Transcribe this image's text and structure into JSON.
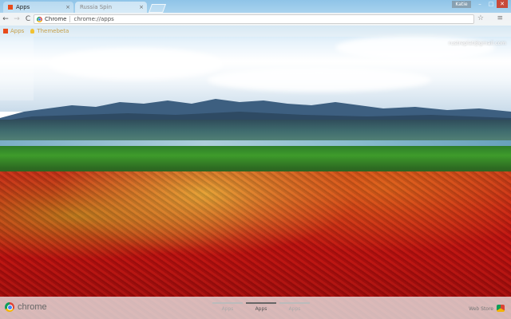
{
  "window": {
    "profile_label": "Katie",
    "minimize_label": "–",
    "restore_label": "□",
    "close_label": "✕"
  },
  "tabs": [
    {
      "title": "Apps"
    },
    {
      "title": "Russia Spin"
    }
  ],
  "toolbar": {
    "back": "←",
    "forward": "→",
    "reload": "C",
    "chip_label": "Chrome",
    "url": "chrome://apps",
    "star": "☆",
    "menu": "≡"
  },
  "bookmarks": {
    "apps_label": "Apps",
    "item1_label": "Themebeta"
  },
  "account": {
    "email": "rustreplat@gmail.com"
  },
  "bottom": {
    "brand": "chrome",
    "pages": [
      {
        "label": "Apps",
        "active": false
      },
      {
        "label": "Apps",
        "active": true
      },
      {
        "label": "Apps",
        "active": false
      }
    ],
    "webstore_label": "Web Store"
  },
  "colors": {
    "accent": "#e84b1a"
  }
}
